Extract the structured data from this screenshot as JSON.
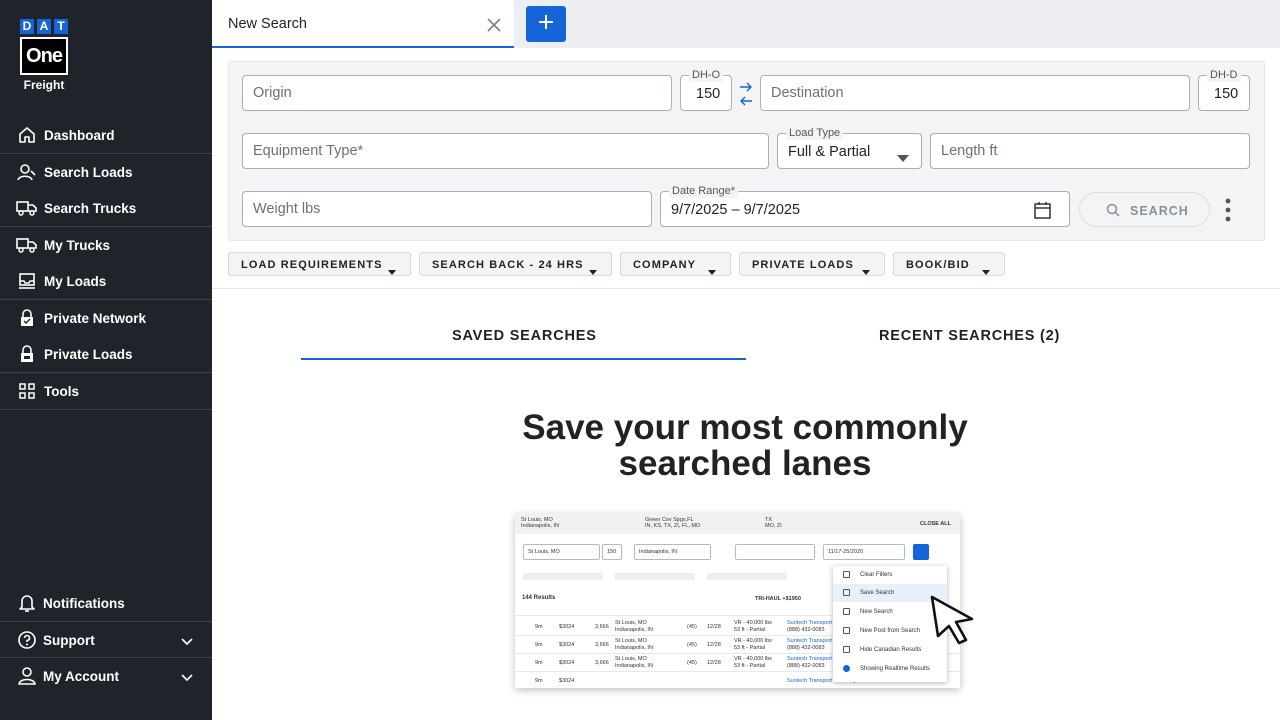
{
  "brand": {
    "dat_letters": [
      "D",
      "A",
      "T"
    ],
    "one": "One",
    "freight": "Freight",
    "accent_color": "#1565d8",
    "sidebar_color": "#1f242b"
  },
  "sidebar": {
    "items": [
      {
        "label": "Dashboard",
        "icon": "home-icon"
      },
      {
        "label": "Search Loads",
        "icon": "search-person-icon"
      },
      {
        "label": "Search Trucks",
        "icon": "truck-search-icon"
      },
      {
        "label": "My Trucks",
        "icon": "truck-icon"
      },
      {
        "label": "My Loads",
        "icon": "inbox-icon"
      },
      {
        "label": "Private Network",
        "icon": "lock-icon"
      },
      {
        "label": "Private Loads",
        "icon": "lock-person-icon"
      },
      {
        "label": "Tools",
        "icon": "grid-icon"
      }
    ],
    "bottom_items": [
      {
        "label": "Notifications",
        "icon": "bell-icon"
      },
      {
        "label": "Support",
        "icon": "help-icon"
      },
      {
        "label": "My Account",
        "icon": "user-icon"
      }
    ]
  },
  "tabs": {
    "active_label": "New Search"
  },
  "search_form": {
    "origin_placeholder": "Origin",
    "dh_o_label": "DH-O",
    "dh_o_value": "150",
    "destination_placeholder": "Destination",
    "dh_d_label": "DH-D",
    "dh_d_value": "150",
    "equipment_placeholder": "Equipment Type*",
    "load_type_label": "Load Type",
    "load_type_value": "Full & Partial",
    "length_placeholder": "Length ft",
    "weight_placeholder": "Weight lbs",
    "date_range_label": "Date Range*",
    "date_range_value": "9/7/2025 – 9/7/2025",
    "search_label": "SEARCH"
  },
  "filters": [
    "LOAD REQUIREMENTS",
    "SEARCH BACK - 24 HRS",
    "COMPANY",
    "PRIVATE LOADS",
    "BOOK/BID"
  ],
  "saved_tabs": {
    "saved": "SAVED SEARCHES",
    "recent": "RECENT SEARCHES (2)"
  },
  "empty_state": {
    "headline_line1": "Save your most commonly",
    "headline_line2": "searched lanes"
  },
  "illustration": {
    "tab1": "St Louis, MO",
    "tab1b": "Indianapolis, IN",
    "tab2": "Green Cov Spgs,FL",
    "tab2b": "IN, KS, TX, ZI, FL, MO",
    "tab3": "TX",
    "tab3b": "MO, ZI",
    "close_all": "CLOSE ALL",
    "origin": "St Louis, MO",
    "dh": "150",
    "destination": "Indianapolis, IN",
    "date": "11/17-25/2020",
    "results": "144 Results",
    "trihaul": "TRI-HAUL +$1950",
    "menu": [
      "Clear Filters",
      "Save Search",
      "New Search",
      "New Post from Search",
      "Hide Canadian Results",
      "Showing Realtime Results"
    ],
    "rows": [
      {
        "age": "9m",
        "rate": "$3024",
        "trip": "3,666",
        "from": "St Louis, MO",
        "to": "Indianapolis, IN",
        "dh": "(45)",
        "pick": "12/28",
        "eq": "VR - 40,000 lbs",
        "eq2": "53 ft - Partial",
        "company": "Suntech Transport",
        "phone": "(888) 432-0083"
      },
      {
        "age": "9m",
        "rate": "$3024",
        "trip": "3,666",
        "from": "St Louis, MO",
        "to": "Indianapolis, IN",
        "dh": "(45)",
        "pick": "12/28",
        "eq": "VR - 40,000 lbs",
        "eq2": "53 ft - Partial",
        "company": "Suntech Transport",
        "phone": "(888) 432-0083"
      },
      {
        "age": "9m",
        "rate": "$3024",
        "trip": "3,666",
        "from": "St Louis, MO",
        "to": "Indianapolis, IN",
        "dh": "(45)",
        "pick": "12/28",
        "eq": "VR - 40,000 lbs",
        "eq2": "53 ft - Partial",
        "company": "Suntech Transport",
        "phone": "(888) 432-0083"
      },
      {
        "age": "9m",
        "rate": "$3024",
        "trip": "",
        "from": "",
        "to": "",
        "dh": "",
        "pick": "",
        "eq": "",
        "eq2": "",
        "company": "Suntech Transport Brokerage",
        "phone": ""
      }
    ]
  }
}
